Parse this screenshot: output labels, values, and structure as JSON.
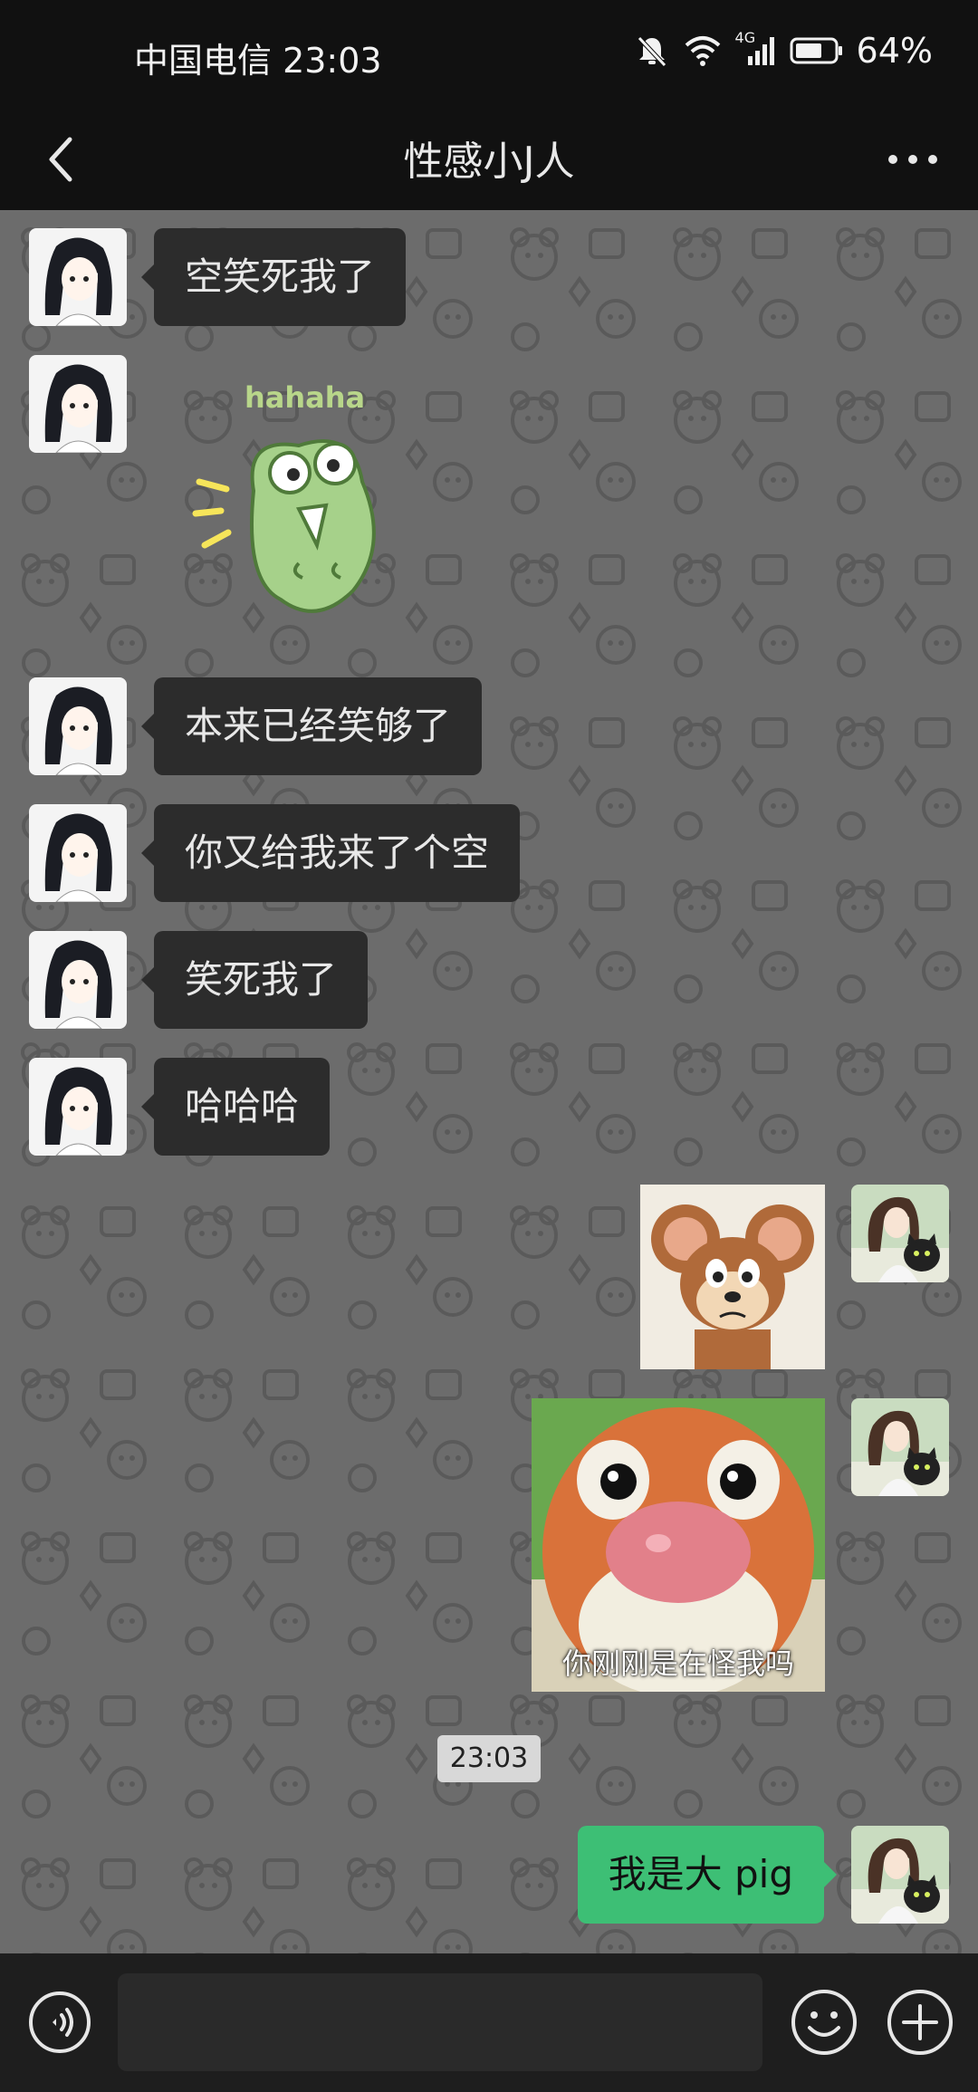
{
  "status_bar": {
    "carrier_time": "中国电信 23:03",
    "network": "4G",
    "battery": "64%",
    "icons": [
      "mute-bell-icon",
      "wifi-icon",
      "signal-icon",
      "battery-icon"
    ]
  },
  "header": {
    "title": "性感小J人",
    "back_icon": "chevron-left-icon",
    "more_icon": "more-dots-icon"
  },
  "messages": [
    {
      "side": "left",
      "type": "text",
      "text": "空笑死我了"
    },
    {
      "side": "left",
      "type": "sticker",
      "content": "green-frog-hahaha-sticker",
      "text": "hahaha"
    },
    {
      "side": "left",
      "type": "text",
      "text": "本来已经笑够了"
    },
    {
      "side": "left",
      "type": "text",
      "text": "你又给我来了个空"
    },
    {
      "side": "left",
      "type": "text",
      "text": "笑死我了"
    },
    {
      "side": "left",
      "type": "text",
      "text": "哈哈哈"
    },
    {
      "side": "right",
      "type": "sticker",
      "content": "cartoon-mouse-sticker"
    },
    {
      "side": "right",
      "type": "sticker",
      "content": "bear-face-sticker",
      "caption": "你刚刚是在怪我吗"
    },
    {
      "type": "timestamp",
      "text": "23:03"
    },
    {
      "side": "right",
      "type": "text",
      "text": "我是大 pig"
    }
  ],
  "input_bar": {
    "placeholder": "",
    "icons": [
      "voice-icon",
      "emoji-icon",
      "plus-icon"
    ]
  },
  "colors": {
    "chat_background": "#6c6c6c",
    "left_bubble": "#2c2c2c",
    "right_bubble": "#3dbf75",
    "bar_background": "#111111"
  }
}
